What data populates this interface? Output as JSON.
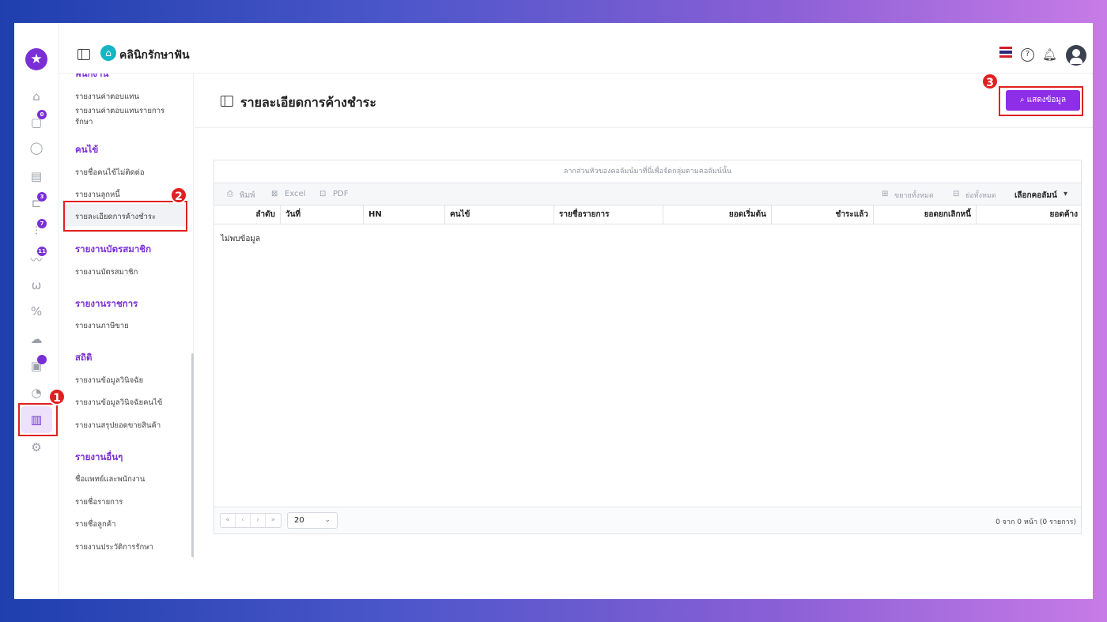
{
  "app": {
    "clinic_name": "คลินิกรักษาฟัน"
  },
  "rail": {
    "badges": {
      "appointments": "0",
      "queue": "3",
      "treatment": "7",
      "payments": "11"
    }
  },
  "menu": {
    "partial_head": "พนักงาน",
    "items_top": [
      "รายงานค่าตอบแทน",
      "รายงานค่าตอบแทนรายการรักษา"
    ],
    "patients_head": "คนไข้",
    "patients": [
      "รายชื่อคนไข้ไม่ติดต่อ",
      "รายงานลูกหนี้",
      "รายละเอียดการค้างชำระ"
    ],
    "membership_head": "รายงานบัตรสมาชิก",
    "membership": [
      "รายงานบัตรสมาชิก"
    ],
    "gov_head": "รายงานราชการ",
    "gov": [
      "รายงานภาษีขาย"
    ],
    "stats_head": "สถิติ",
    "stats": [
      "รายงานข้อมูลวินิจฉัย",
      "รายงานข้อมูลวินิจฉัยคนไข้",
      "รายงานสรุปยอดขายสินค้า"
    ],
    "other_head": "รายงานอื่นๆ",
    "other": [
      "ชื่อแพทย์และพนักงาน",
      "รายชื่อรายการ",
      "รายชื่อลูกค้า",
      "รายงานประวัติการรักษา"
    ]
  },
  "page": {
    "title": "รายละเอียดการค้างชำระ",
    "show_button": "แสดงข้อมูล"
  },
  "grid": {
    "group_hint": "ลากส่วนหัวของคอลัมน์มาที่นี่เพื่อจัดกลุ่มตามคอลัมน์นั้น",
    "toolbar": {
      "print": "พิมพ์",
      "excel": "Excel",
      "pdf": "PDF",
      "expand_all": "ขยายทั้งหมด",
      "collapse_all": "ย่อทั้งหมด",
      "choose_columns": "เลือกคอลัมน์"
    },
    "columns": [
      "ลำดับ",
      "วันที่",
      "HN",
      "คนไข้",
      "รายชื่อรายการ",
      "ยอดเริ่มต้น",
      "ชำระแล้ว",
      "ยอดยกเลิกหนี้",
      "ยอดค้าง"
    ],
    "empty_text": "ไม่พบข้อมูล",
    "pager": {
      "buttons": [
        "«",
        "‹",
        "›",
        "»"
      ],
      "page_size": "20",
      "info": "0 จาก 0 หน้า (0 รายการ)"
    }
  },
  "annotations": {
    "step1": "1",
    "step2": "2",
    "step3": "3"
  },
  "colors": {
    "accent": "#8e2ee8",
    "highlight": "#e02020"
  }
}
